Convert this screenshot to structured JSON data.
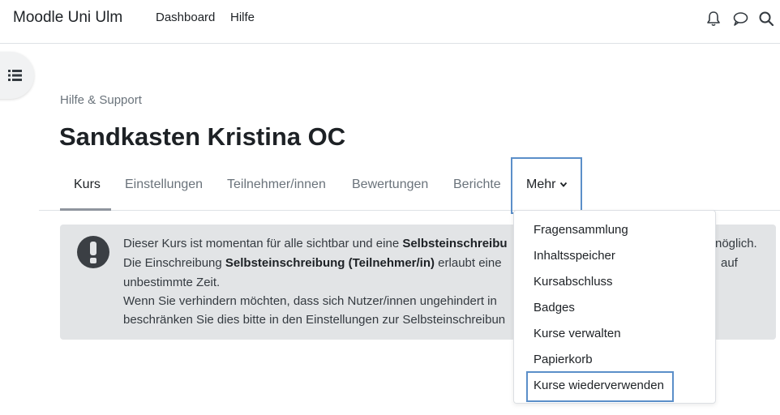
{
  "navbar": {
    "brand": "Moodle Uni Ulm",
    "links": [
      "Dashboard",
      "Hilfe"
    ],
    "icons": [
      "bell-icon",
      "chat-icon",
      "search-icon"
    ]
  },
  "breadcrumb": "Hilfe & Support",
  "page_title": "Sandkasten Kristina OC",
  "tabs": [
    {
      "label": "Kurs",
      "active": true
    },
    {
      "label": "Einstellungen"
    },
    {
      "label": "Teilnehmer/innen"
    },
    {
      "label": "Bewertungen"
    },
    {
      "label": "Berichte"
    },
    {
      "label": "Mehr"
    }
  ],
  "alert": {
    "line1_pre": "Dieser Kurs ist momentan für alle sichtbar und eine ",
    "line1_bold": "Selbsteinschreibu",
    "line1_end": "nöglich.",
    "line2_pre": "Die Einschreibung ",
    "line2_bold": "Selbsteinschreibung (Teilnehmer/in)",
    "line2_post": " erlaubt eine",
    "line2_end": "auf",
    "line3": "unbestimmte Zeit.",
    "line4": "Wenn Sie verhindern möchten, dass sich Nutzer/innen ungehindert in",
    "line5": "beschränken Sie dies bitte in den Einstellungen zur Selbsteinschreibun"
  },
  "dropdown": {
    "items": [
      "Fragensammlung",
      "Inhaltsspeicher",
      "Kursabschluss",
      "Badges",
      "Kurse verwalten",
      "Papierkorb",
      "Kurse wiederverwenden"
    ]
  },
  "colors": {
    "highlight": "#5b8fc9",
    "alert_bg": "#e2e4e6",
    "muted_text": "#6a737b"
  }
}
